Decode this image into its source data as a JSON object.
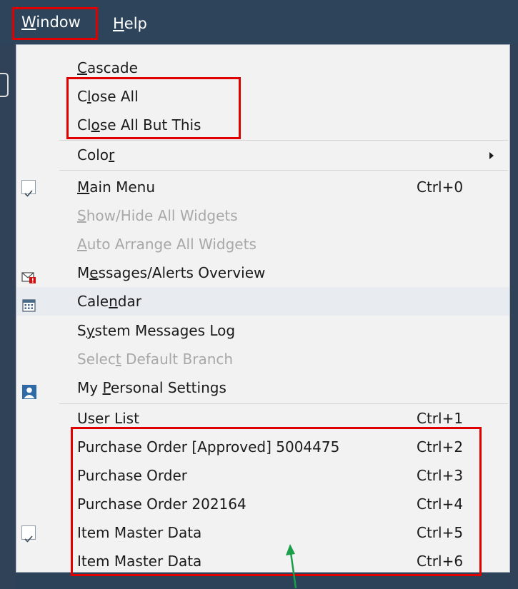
{
  "menubar": {
    "window": {
      "before": "",
      "mnemonic": "W",
      "after": "indow"
    },
    "help": {
      "before": "",
      "mnemonic": "H",
      "after": "elp"
    }
  },
  "menu": {
    "cascade": {
      "before": "",
      "mnemonic": "C",
      "after": "ascade"
    },
    "close_all": {
      "before": "C",
      "mnemonic": "l",
      "after": "ose All"
    },
    "close_all_but_this": {
      "before": "Cl",
      "mnemonic": "o",
      "after": "se All But This"
    },
    "color": {
      "before": "Colo",
      "mnemonic": "r",
      "after": ""
    },
    "main_menu": {
      "before": "",
      "mnemonic": "M",
      "after": "ain Menu",
      "shortcut": "Ctrl+0"
    },
    "show_hide_widgets": {
      "before": "",
      "mnemonic": "S",
      "after": "how/Hide All Widgets"
    },
    "auto_arrange_widgets": {
      "before": "",
      "mnemonic": "A",
      "after": "uto Arrange All Widgets"
    },
    "messages_alerts": {
      "before": "M",
      "mnemonic": "e",
      "after": "ssages/Alerts Overview"
    },
    "calendar": {
      "before": "Cale",
      "mnemonic": "n",
      "after": "dar"
    },
    "system_messages_log": {
      "before": "S",
      "mnemonic": "y",
      "after": "stem Messages Log"
    },
    "select_default_branch": {
      "before": "Selec",
      "mnemonic": "t",
      "after": " Default Branch"
    },
    "my_personal_settings": {
      "before": "My ",
      "mnemonic": "P",
      "after": "ersonal Settings"
    },
    "windows": [
      {
        "label": "User List",
        "shortcut": "Ctrl+1"
      },
      {
        "label": "Purchase Order [Approved] 5004475",
        "shortcut": "Ctrl+2"
      },
      {
        "label": "Purchase Order",
        "shortcut": "Ctrl+3"
      },
      {
        "label": "Purchase Order 202164",
        "shortcut": "Ctrl+4"
      },
      {
        "label": "Item Master Data",
        "shortcut": "Ctrl+5"
      },
      {
        "label": "Item Master Data",
        "shortcut": "Ctrl+6"
      }
    ]
  },
  "colors": {
    "highlight": "#e00000",
    "arrow": "#1a9e4a",
    "menubar": "#2e445b"
  },
  "icons": {
    "check": "checkmark-icon",
    "messages": "envelope-alert-icon",
    "calendar": "calendar-icon",
    "settings": "user-icon",
    "submenu": "chevron-right-icon"
  }
}
